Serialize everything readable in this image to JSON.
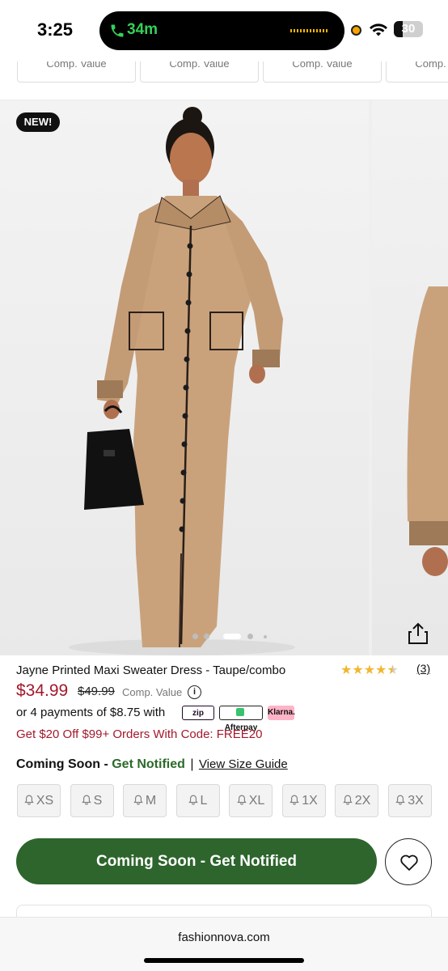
{
  "status": {
    "time": "3:25",
    "call_timer": "34m",
    "battery_level": "30",
    "battery_fraction": 0.3
  },
  "comparison_strip": {
    "cards": [
      "Comp. Value",
      "Comp. Value",
      "Comp. Value",
      "Comp. Value"
    ]
  },
  "gallery": {
    "badge": "NEW!",
    "slide_count": 4,
    "active_slide": 2
  },
  "product": {
    "title": "Jayne Printed Maxi Sweater Dress - Taupe/combo",
    "rating_stars": 4.5,
    "review_count": "(3)",
    "price": "$34.99",
    "original_price": "$49.99",
    "comp_value_label": "Comp. Value",
    "info_icon": "i",
    "installments_text": "or 4 payments of $8.75 with",
    "payment_providers": [
      "zip",
      "Afterpay",
      "Klarna."
    ],
    "promo": "Get $20 Off $99+ Orders With Code: FREE20"
  },
  "availability": {
    "label": "Coming Soon",
    "separator": "-",
    "notify_link": "Get Notified",
    "pipe": "|",
    "size_guide_link": "View Size Guide"
  },
  "sizes": [
    "XS",
    "S",
    "M",
    "L",
    "XL",
    "1X",
    "2X",
    "3X"
  ],
  "actions": {
    "cta_label": "Coming Soon - Get Notified"
  },
  "browser": {
    "url": "fashionnova.com"
  },
  "colors": {
    "price_red": "#a3192b",
    "brand_green": "#2d652c",
    "notify_green": "#2c6a2a",
    "star_gold": "#f2b632"
  }
}
